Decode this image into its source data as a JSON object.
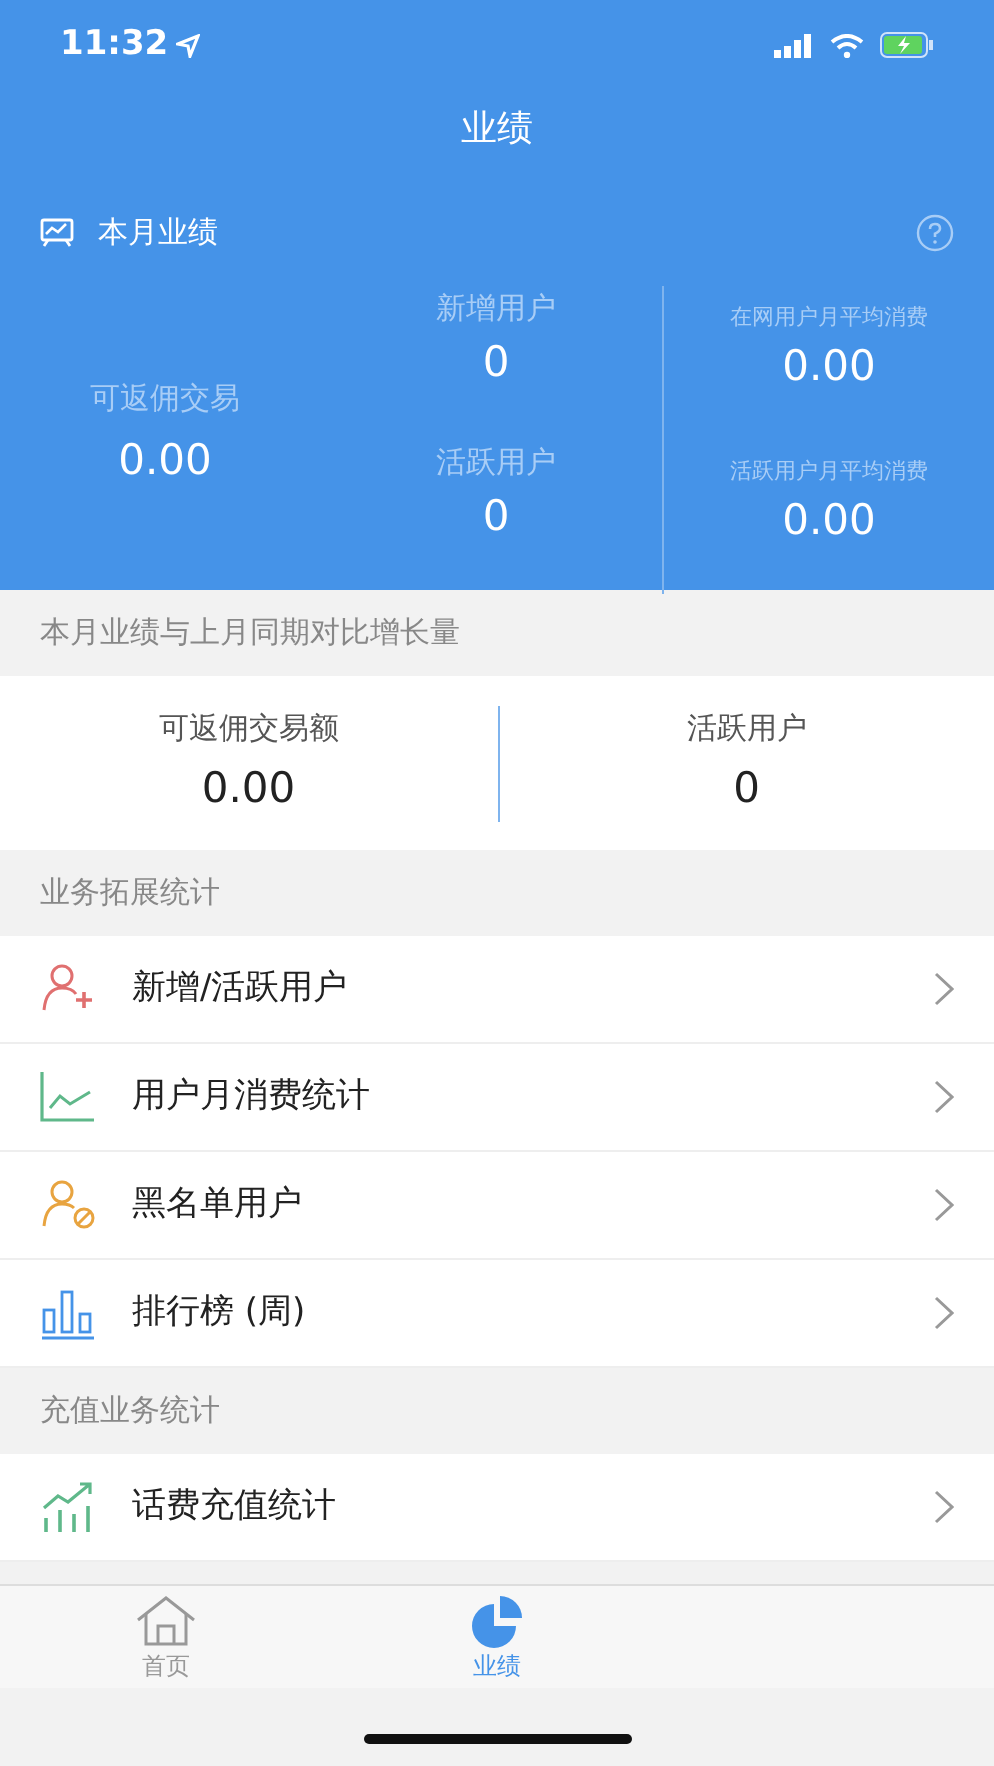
{
  "status_bar": {
    "time": "11:32"
  },
  "header": {
    "title": "业绩",
    "section_title": "本月业绩",
    "main_stat": {
      "label": "可返佣交易",
      "value": "0.00"
    },
    "stats": [
      {
        "label": "新增用户",
        "value": "0"
      },
      {
        "label": "在网用户月平均消费",
        "value": "0.00"
      },
      {
        "label": "活跃用户",
        "value": "0"
      },
      {
        "label": "活跃用户月平均消费",
        "value": "0.00"
      }
    ]
  },
  "comparison": {
    "title": "本月业绩与上月同期对比增长量",
    "stats": [
      {
        "label": "可返佣交易额",
        "value": "0.00"
      },
      {
        "label": "活跃用户",
        "value": "0"
      }
    ]
  },
  "sections": [
    {
      "title": "业务拓展统计",
      "items": [
        {
          "kind": "add-user",
          "label": "新增/活跃用户"
        },
        {
          "kind": "line-chart",
          "label": "用户月消费统计"
        },
        {
          "kind": "blocked-user",
          "label": "黑名单用户"
        },
        {
          "kind": "bar-chart",
          "label": "排行榜 (周)"
        }
      ]
    },
    {
      "title": "充值业务统计",
      "items": [
        {
          "kind": "growth-chart",
          "label": "话费充值统计"
        }
      ]
    }
  ],
  "tab_bar": [
    {
      "kind": "home",
      "label": "首页",
      "selected": false
    },
    {
      "kind": "pie",
      "label": "业绩",
      "selected": true
    }
  ]
}
